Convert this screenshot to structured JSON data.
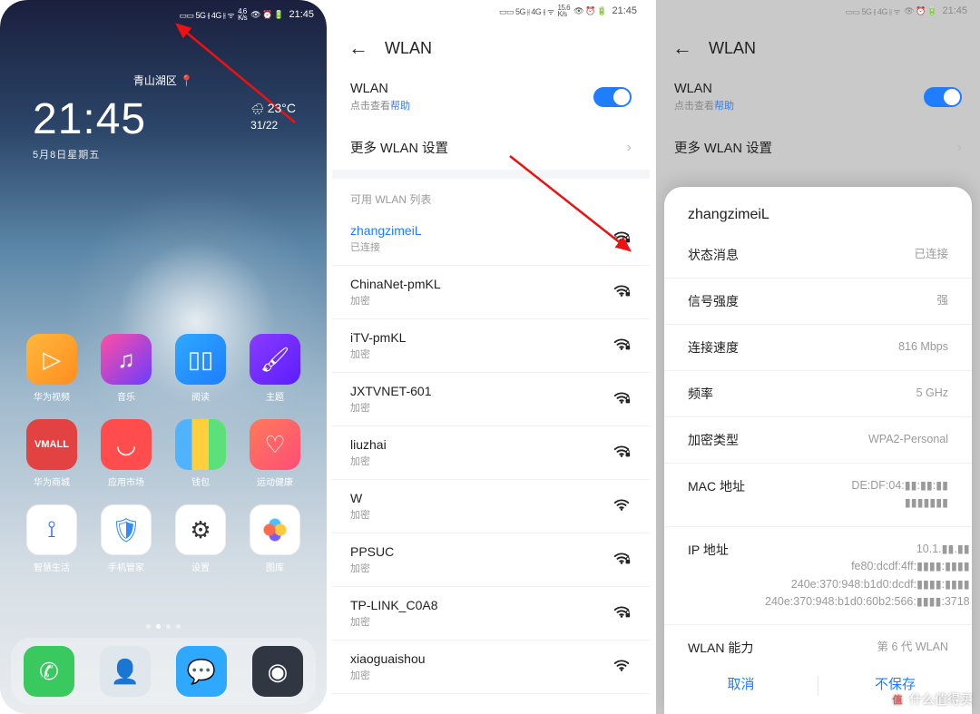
{
  "status": {
    "signals": "▭▭ 5G ⫲ 4G ⫲ ᯤ",
    "speed1": "4.6\nK/s",
    "speed2": "15.6\nK/s",
    "icons": "👁 ⏰ 🔋",
    "time": "21:45"
  },
  "home": {
    "location": "青山湖区",
    "clock_time": "21:45",
    "clock_date": "5月8日星期五",
    "weather_temp": "23°C",
    "weather_range": "31/22",
    "apps": [
      {
        "label": "华为视频",
        "cls": "c-vid",
        "glyph": "▷"
      },
      {
        "label": "音乐",
        "cls": "c-music",
        "glyph": "♫"
      },
      {
        "label": "阅读",
        "cls": "c-read",
        "glyph": "▯▯"
      },
      {
        "label": "主题",
        "cls": "c-theme",
        "glyph": "🖌"
      },
      {
        "label": "华为商城",
        "cls": "c-vmall",
        "glyph": "VMALL"
      },
      {
        "label": "应用市场",
        "cls": "c-market",
        "glyph": "◡"
      },
      {
        "label": "钱包",
        "cls": "c-wallet",
        "glyph": ""
      },
      {
        "label": "运动健康",
        "cls": "c-health",
        "glyph": "♡"
      },
      {
        "label": "智慧生活",
        "cls": "c-smart",
        "glyph": "⟟"
      },
      {
        "label": "手机管家",
        "cls": "c-guard",
        "glyph": "🛡"
      },
      {
        "label": "设置",
        "cls": "c-set",
        "glyph": "⚙"
      },
      {
        "label": "图库",
        "cls": "c-gal",
        "glyph": ""
      }
    ],
    "dock": [
      {
        "name": "phone",
        "cls": "c-phone",
        "glyph": "✆"
      },
      {
        "name": "contacts",
        "cls": "c-contact",
        "glyph": "👤"
      },
      {
        "name": "messages",
        "cls": "c-sms",
        "glyph": "💬"
      },
      {
        "name": "camera",
        "cls": "c-cam",
        "glyph": "◉"
      }
    ]
  },
  "wlan": {
    "title": "WLAN",
    "switch_label": "WLAN",
    "help_prefix": "点击查看",
    "help_link": "帮助",
    "more": "更多 WLAN 设置",
    "list_title": "可用 WLAN 列表",
    "connected_sub": "已连接",
    "encrypted": "加密",
    "networks": [
      {
        "ssid": "zhangzimeiL",
        "connected": true,
        "band": "6",
        "locked": true
      },
      {
        "ssid": "ChinaNet-pmKL",
        "locked": true
      },
      {
        "ssid": "iTV-pmKL",
        "locked": true
      },
      {
        "ssid": "JXTVNET-601",
        "locked": true
      },
      {
        "ssid": "liuzhai",
        "locked": true
      },
      {
        "ssid": "W",
        "locked": false
      },
      {
        "ssid": "PPSUC",
        "locked": true
      },
      {
        "ssid": "TP-LINK_C0A8",
        "locked": true
      },
      {
        "ssid": "xiaoguaishou"
      }
    ]
  },
  "detail": {
    "ssid": "zhangzimeiL",
    "rows": [
      {
        "k": "状态消息",
        "v": "已连接"
      },
      {
        "k": "信号强度",
        "v": "强"
      },
      {
        "k": "连接速度",
        "v": "816 Mbps"
      },
      {
        "k": "频率",
        "v": "5 GHz"
      },
      {
        "k": "加密类型",
        "v": "WPA2-Personal"
      },
      {
        "k": "MAC 地址",
        "v": "DE:DF:04:▮▮:▮▮:▮▮\n▮▮▮▮▮▮▮"
      },
      {
        "k": "IP 地址",
        "v": "10.1.▮▮.▮▮\nfe80:dcdf:4ff:▮▮▮▮:▮▮▮▮\n240e:370:948:b1d0:dcdf:▮▮▮▮:▮▮▮▮\n240e:370:948:b1d0:60b2:566:▮▮▮▮:3718"
      },
      {
        "k": "WLAN 能力",
        "v": "第 6 代 WLAN"
      }
    ],
    "cancel": "取消",
    "nosave": "不保存"
  },
  "watermark": "什么值得买"
}
